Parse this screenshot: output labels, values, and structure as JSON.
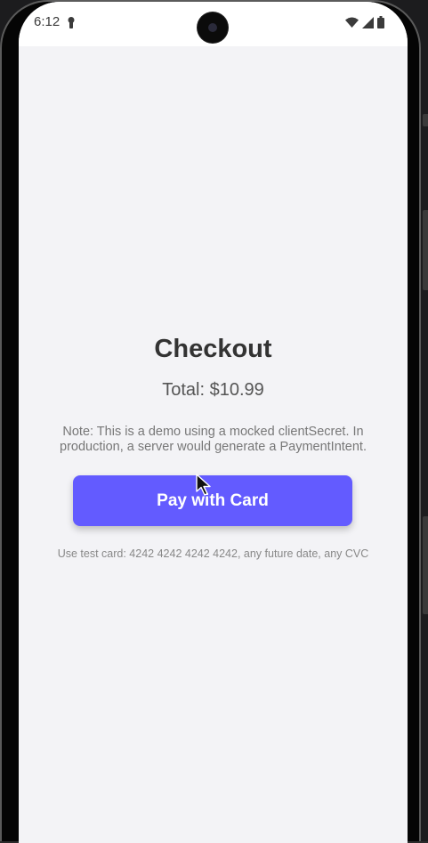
{
  "status_bar": {
    "time": "6:12",
    "icons": [
      "lock-icon",
      "wifi-icon",
      "signal-icon",
      "battery-icon"
    ]
  },
  "checkout": {
    "title": "Checkout",
    "total": "Total: $10.99",
    "note": "Note: This is a demo using a mocked clientSecret. In production, a server would generate a PaymentIntent.",
    "pay_button_label": "Pay with Card",
    "test_card_hint": "Use test card: 4242 4242 4242 4242, any future date, any CVC"
  },
  "colors": {
    "accent": "#635bff",
    "background": "#f3f3f6",
    "title_text": "#333333"
  }
}
